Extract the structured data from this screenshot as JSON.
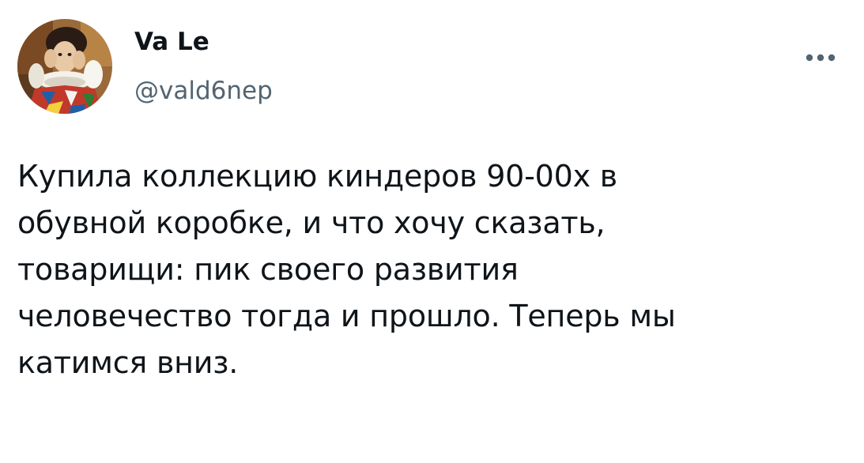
{
  "author": {
    "display_name": "Va Le",
    "handle": "@vald6nep",
    "avatar_icon": "avatar-painting-image"
  },
  "more_menu": {
    "icon": "more-horizontal-icon"
  },
  "tweet": {
    "text": "Купила коллекцию киндеров 90-00х в\nобувной коробке, и что хочу сказать,\nтоварищи: пик своего развития\nчеловечество тогда и прошло. Теперь мы\nкатимся вниз."
  },
  "colors": {
    "text_primary": "#0f1419",
    "text_secondary": "#536471",
    "background": "#ffffff"
  }
}
